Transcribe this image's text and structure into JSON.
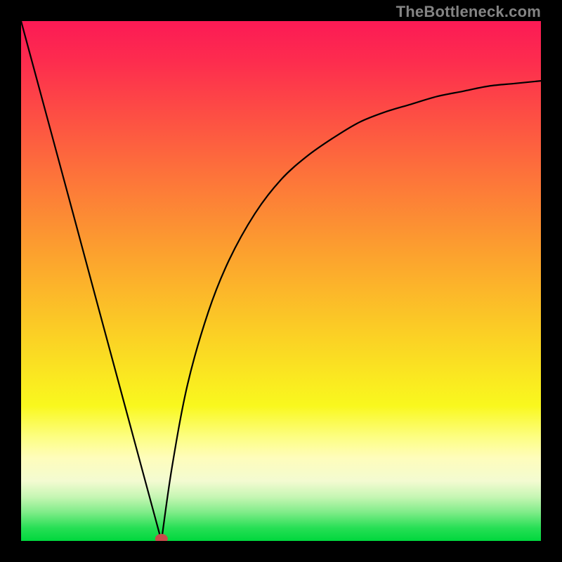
{
  "watermark": "TheBottleneck.com",
  "chart_data": {
    "type": "line",
    "title": "",
    "xlabel": "",
    "ylabel": "",
    "xlim": [
      0,
      1
    ],
    "ylim": [
      0,
      1
    ],
    "grid": false,
    "legend": false,
    "note": "The black curve is the result of two branches; values estimated from pixel positions (1.0 = top, 0.0 = bottom).",
    "branch_left": {
      "x": [
        0.0,
        0.05,
        0.1,
        0.15,
        0.2,
        0.25,
        0.27
      ],
      "y": [
        1.0,
        0.815,
        0.63,
        0.444,
        0.259,
        0.074,
        0.0
      ]
    },
    "branch_right": {
      "x": [
        0.27,
        0.29,
        0.32,
        0.36,
        0.4,
        0.45,
        0.5,
        0.55,
        0.6,
        0.65,
        0.7,
        0.75,
        0.8,
        0.85,
        0.9,
        0.95,
        1.0
      ],
      "y": [
        0.0,
        0.14,
        0.3,
        0.44,
        0.54,
        0.63,
        0.695,
        0.74,
        0.775,
        0.805,
        0.825,
        0.84,
        0.855,
        0.865,
        0.875,
        0.88,
        0.885
      ]
    },
    "marker": {
      "x": 0.27,
      "y": 0.0,
      "color": "#c84b4b"
    },
    "background_gradient": {
      "stops": [
        {
          "pos": 0.0,
          "color": "#fc1a55"
        },
        {
          "pos": 0.08,
          "color": "#fd2d4e"
        },
        {
          "pos": 0.18,
          "color": "#fd4e44"
        },
        {
          "pos": 0.3,
          "color": "#fd743a"
        },
        {
          "pos": 0.45,
          "color": "#fca22e"
        },
        {
          "pos": 0.6,
          "color": "#fbcf25"
        },
        {
          "pos": 0.74,
          "color": "#f9f81e"
        },
        {
          "pos": 0.8,
          "color": "#fdfe82"
        },
        {
          "pos": 0.84,
          "color": "#fefdbb"
        },
        {
          "pos": 0.885,
          "color": "#f3fbd1"
        },
        {
          "pos": 0.915,
          "color": "#c7f6b4"
        },
        {
          "pos": 0.945,
          "color": "#7fec88"
        },
        {
          "pos": 0.975,
          "color": "#27df55"
        },
        {
          "pos": 1.0,
          "color": "#00d73d"
        }
      ]
    }
  }
}
